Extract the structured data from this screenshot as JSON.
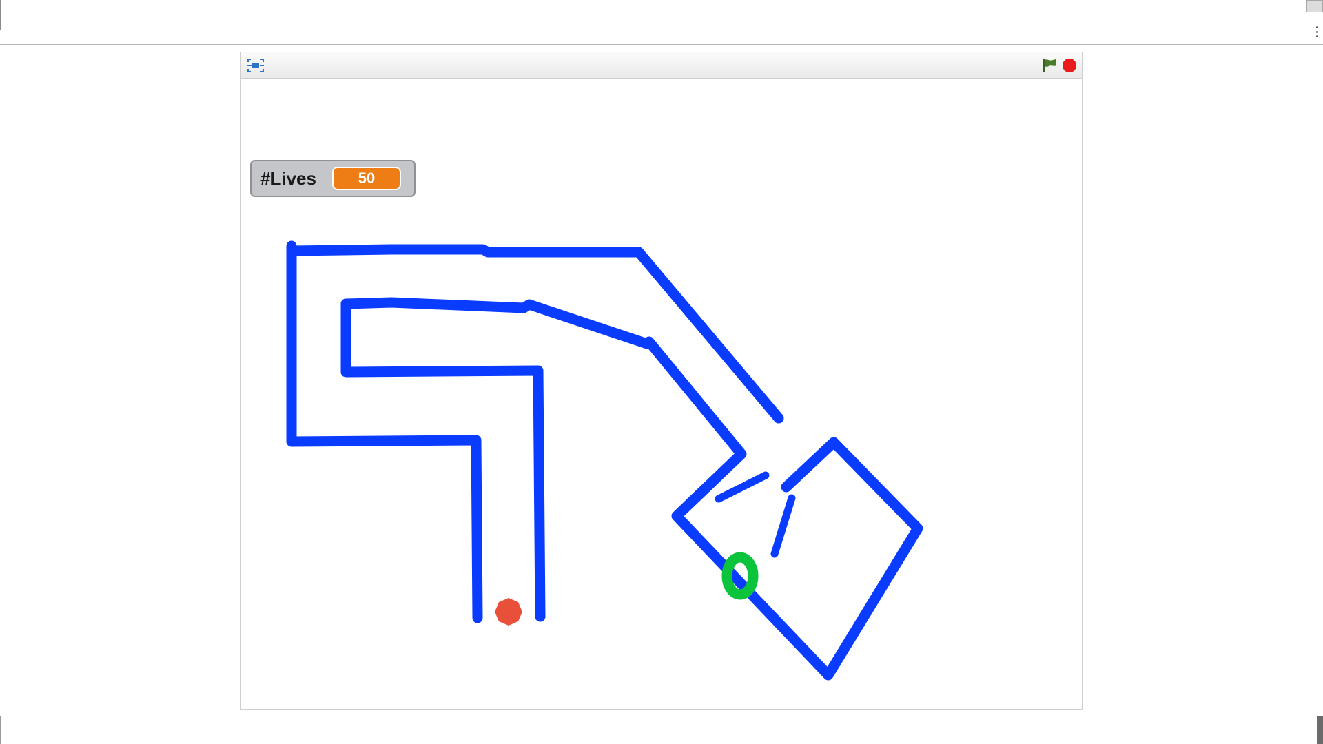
{
  "monitor": {
    "label": "#Lives",
    "value": "50"
  },
  "colors": {
    "maze_wall": "#0a3cff",
    "goal": "#0cc43c",
    "player": "#e8503a",
    "monitor_value_bg": "#ee7d16",
    "flag": "#4a7a2c",
    "stop": "#e81c1c"
  },
  "icons": {
    "fullscreen": "fullscreen-icon",
    "start": "green-flag-icon",
    "stop": "stop-sign-icon"
  }
}
